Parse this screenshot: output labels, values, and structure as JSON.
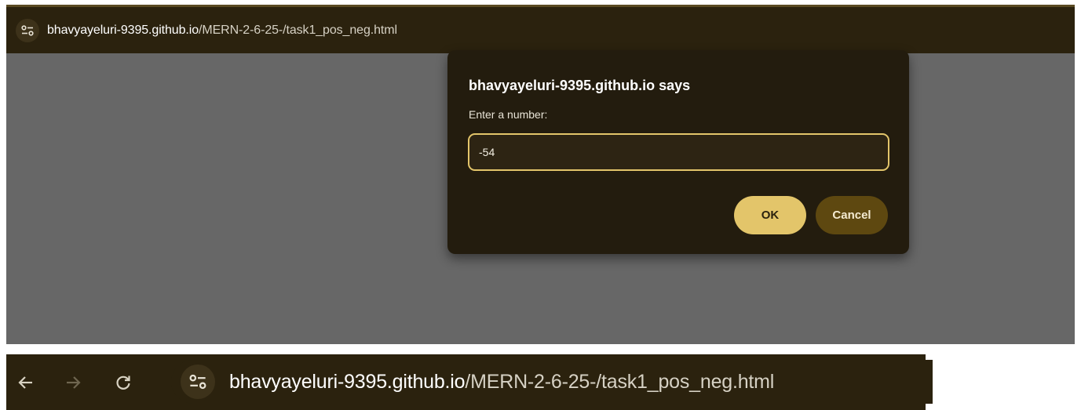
{
  "top_window": {
    "url_host": "bhavyayeluri-9395.github.io",
    "url_path": "/MERN-2-6-25-/task1_pos_neg.html",
    "site_info_icon": "tune-icon"
  },
  "dialog": {
    "title": "bhavyayeluri-9395.github.io says",
    "message": "Enter a number:",
    "input_value": "-54",
    "ok_label": "OK",
    "cancel_label": "Cancel"
  },
  "bottom_toolbar": {
    "back_icon": "arrow-left-icon",
    "forward_icon": "arrow-right-icon",
    "reload_icon": "reload-icon",
    "url_host": "bhavyayeluri-9395.github.io",
    "url_path": "/MERN-2-6-25-/task1_pos_neg.html"
  },
  "colors": {
    "chrome_bg": "#2b220e",
    "page_overlay": "#676767",
    "dialog_bg": "#231c0e",
    "accent": "#e3c56a",
    "cancel_bg": "#5e4810"
  }
}
